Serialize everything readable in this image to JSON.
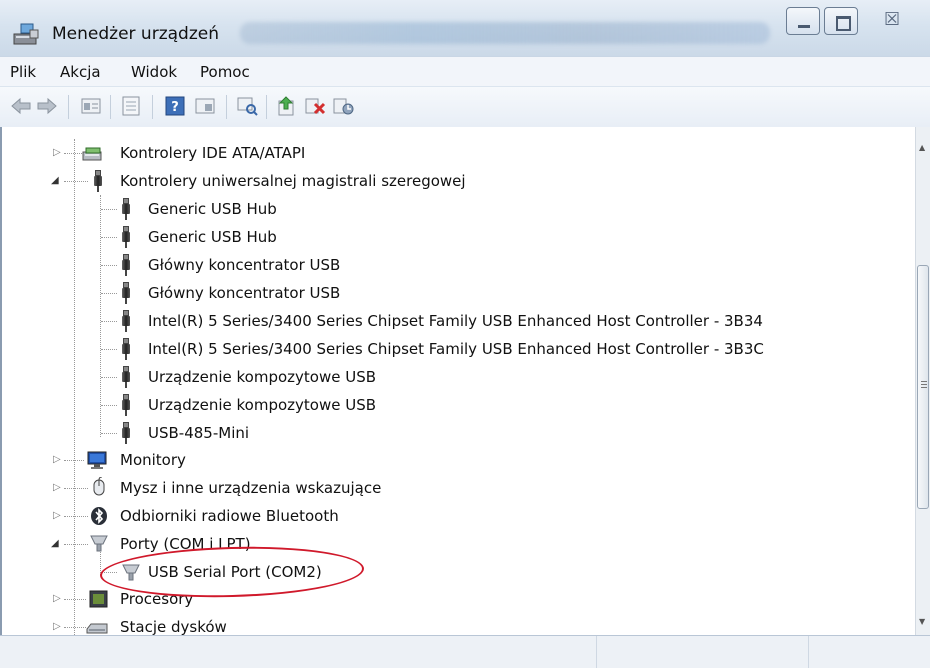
{
  "window": {
    "title": "Menedżer urządzeń",
    "controls": [
      "minimize",
      "maximize",
      "close"
    ]
  },
  "menu": {
    "items": [
      "Plik",
      "Akcja",
      "Widok",
      "Pomoc"
    ]
  },
  "toolbar": {
    "buttons": [
      "back-arrow-icon",
      "forward-arrow-icon",
      "properties-icon",
      "view-icon",
      "help-icon",
      "view-resources-icon",
      "scan-hardware-icon",
      "update-driver-icon",
      "uninstall-icon",
      "disable-icon"
    ]
  },
  "tree": {
    "nodes": [
      {
        "label": "Kontrolery IDE ATA/ATAPI",
        "expander": "▷",
        "icon": "ide-controller-icon"
      },
      {
        "label": "Kontrolery uniwersalnej magistrali szeregowej",
        "expander": "◢",
        "icon": "usb-icon"
      },
      {
        "label": "Generic USB Hub",
        "icon": "usb-icon"
      },
      {
        "label": "Generic USB Hub",
        "icon": "usb-icon"
      },
      {
        "label": "Główny koncentrator USB",
        "icon": "usb-icon"
      },
      {
        "label": "Główny koncentrator USB",
        "icon": "usb-icon"
      },
      {
        "label": "Intel(R) 5 Series/3400 Series Chipset Family USB Enhanced Host Controller - 3B34",
        "icon": "usb-icon"
      },
      {
        "label": "Intel(R) 5 Series/3400 Series Chipset Family USB Enhanced Host Controller - 3B3C",
        "icon": "usb-icon"
      },
      {
        "label": "Urządzenie kompozytowe USB",
        "icon": "usb-icon"
      },
      {
        "label": "Urządzenie kompozytowe USB",
        "icon": "usb-icon"
      },
      {
        "label": "USB-485-Mini",
        "icon": "usb-icon"
      },
      {
        "label": "Monitory",
        "expander": "▷",
        "icon": "monitor-icon"
      },
      {
        "label": "Mysz i inne urządzenia wskazujące",
        "expander": "▷",
        "icon": "mouse-icon"
      },
      {
        "label": "Odbiorniki radiowe Bluetooth",
        "expander": "▷",
        "icon": "bluetooth-icon"
      },
      {
        "label": "Porty (COM i LPT)",
        "expander": "◢",
        "icon": "port-icon"
      },
      {
        "label": "USB Serial Port (COM2)",
        "icon": "port-icon"
      },
      {
        "label": "Procesory",
        "expander": "▷",
        "icon": "processor-icon"
      },
      {
        "label": "Stacje dysków",
        "expander": "▷",
        "icon": "disk-drive-icon"
      }
    ]
  },
  "annotation": {
    "color": "#d0192b",
    "target": "USB Serial Port (COM2)"
  }
}
